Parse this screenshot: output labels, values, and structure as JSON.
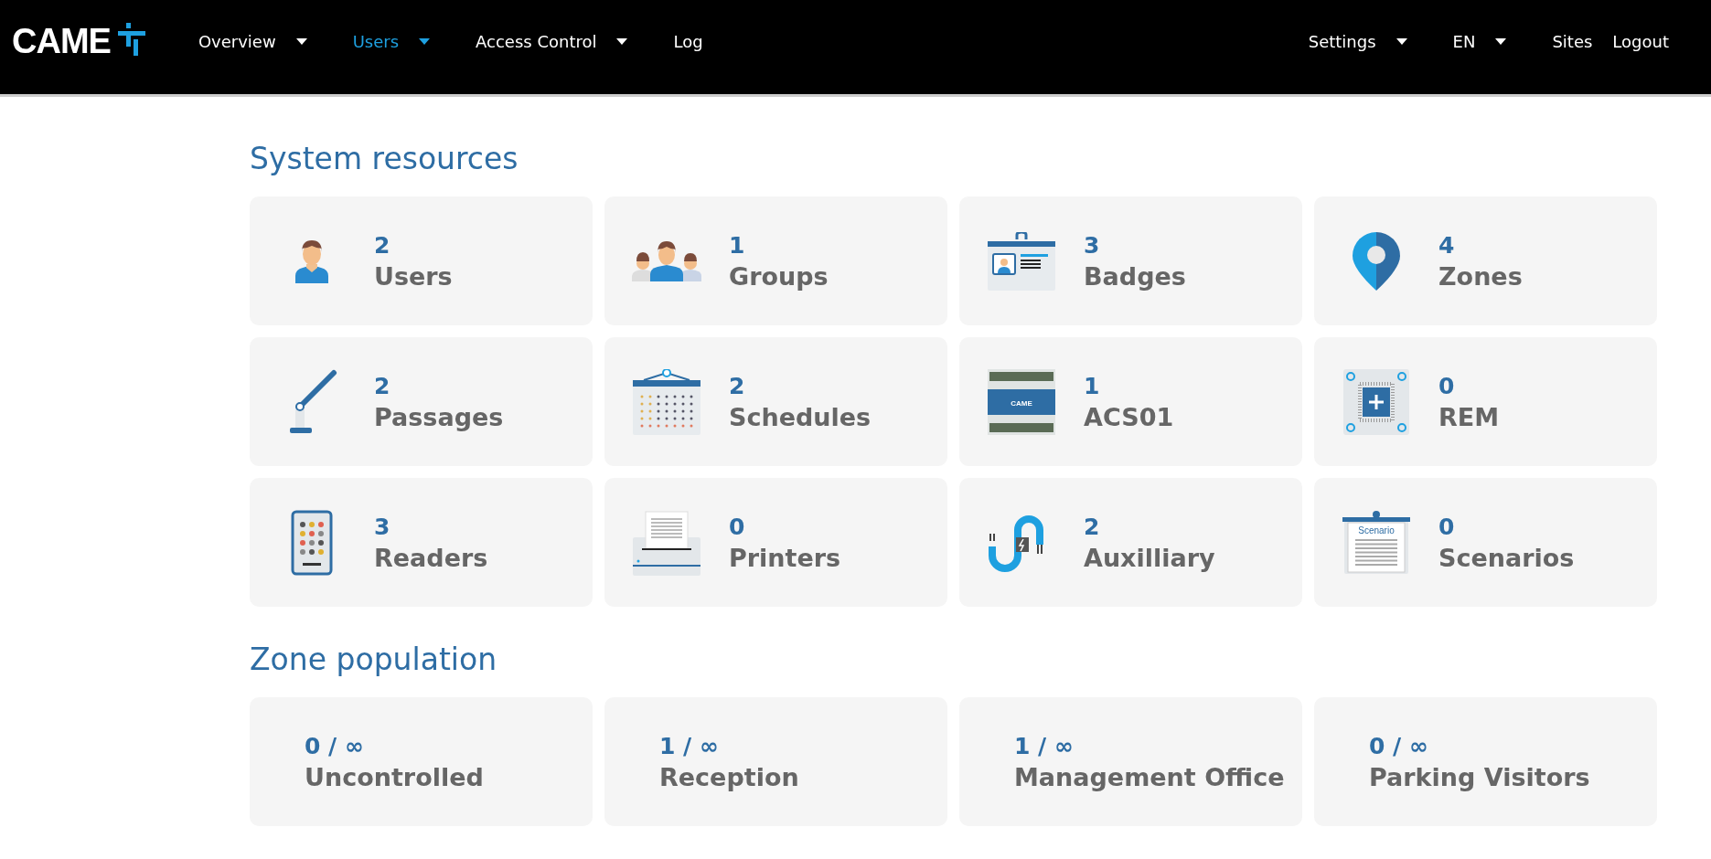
{
  "header": {
    "logo": "CAME",
    "nav": [
      {
        "label": "Overview",
        "dropdown": true,
        "selected": false
      },
      {
        "label": "Users",
        "dropdown": true,
        "selected": true
      },
      {
        "label": "Access Control",
        "dropdown": true,
        "selected": false
      },
      {
        "label": "Log",
        "dropdown": false,
        "selected": false
      }
    ],
    "right_nav": [
      {
        "label": "Settings",
        "dropdown": true
      },
      {
        "label": "EN",
        "dropdown": true
      },
      {
        "label": "Sites",
        "dropdown": false
      },
      {
        "label": "Logout",
        "dropdown": false
      }
    ]
  },
  "system_resources": {
    "title": "System resources",
    "items": [
      {
        "kind": "user",
        "count": "2",
        "label": "Users"
      },
      {
        "kind": "group",
        "count": "1",
        "label": "Groups"
      },
      {
        "kind": "badge",
        "count": "3",
        "label": "Badges"
      },
      {
        "kind": "zone",
        "count": "4",
        "label": "Zones"
      },
      {
        "kind": "passage",
        "count": "2",
        "label": "Passages"
      },
      {
        "kind": "schedule",
        "count": "2",
        "label": "Schedules"
      },
      {
        "kind": "controller",
        "count": "1",
        "label": "ACS01",
        "icon_text": "CAME"
      },
      {
        "kind": "rem",
        "count": "0",
        "label": "REM"
      },
      {
        "kind": "reader",
        "count": "3",
        "label": "Readers"
      },
      {
        "kind": "printer",
        "count": "0",
        "label": "Printers"
      },
      {
        "kind": "auxiliary",
        "count": "2",
        "label": "Auxilliary"
      },
      {
        "kind": "scenario",
        "count": "0",
        "label": "Scenarios",
        "icon_text": "Scenario"
      }
    ]
  },
  "zone_population": {
    "title": "Zone population",
    "items": [
      {
        "count": "0 / ∞",
        "label": "Uncontrolled"
      },
      {
        "count": "1 / ∞",
        "label": "Reception"
      },
      {
        "count": "1 / ∞",
        "label": "Management Office"
      },
      {
        "count": "0 / ∞",
        "label": "Parking Visitors"
      }
    ]
  }
}
